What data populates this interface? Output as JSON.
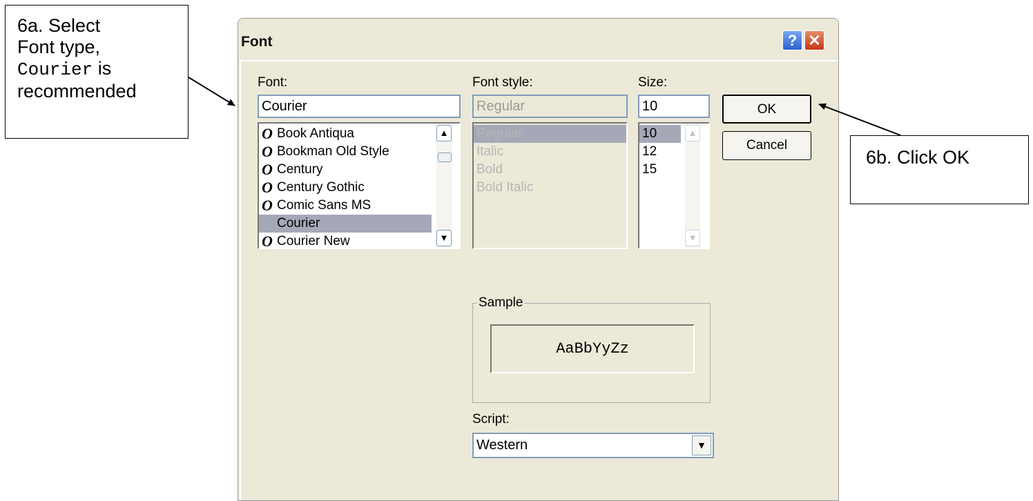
{
  "annotations": {
    "select_font": {
      "line1": "6a.   Select",
      "line2": "Font type,",
      "mono": "Courier",
      "after_mono": " is",
      "line4": "recommended"
    },
    "click_ok": {
      "text": "6b.   Click OK"
    }
  },
  "dialog": {
    "title": "Font",
    "help_glyph": "?",
    "close_glyph": "✕",
    "font": {
      "label": "Font:",
      "value": "Courier",
      "items": [
        {
          "icon": "O",
          "name": "Book Antiqua"
        },
        {
          "icon": "O",
          "name": "Bookman Old Style"
        },
        {
          "icon": "O",
          "name": "Century"
        },
        {
          "icon": "O",
          "name": "Century Gothic"
        },
        {
          "icon": "O",
          "name": "Comic Sans MS"
        },
        {
          "icon": "",
          "name": "Courier",
          "selected": true
        },
        {
          "icon": "O",
          "name": "Courier New"
        }
      ]
    },
    "style": {
      "label": "Font style:",
      "value": "Regular",
      "items": [
        "Regular",
        "Italic",
        "Bold",
        "Bold Italic"
      ]
    },
    "size": {
      "label": "Size:",
      "value": "10",
      "items": [
        "10",
        "12",
        "15"
      ]
    },
    "ok": "OK",
    "cancel": "Cancel",
    "sample": {
      "label": "Sample",
      "text": "AaBbYyZz"
    },
    "script": {
      "label": "Script:",
      "value": "Western"
    }
  },
  "colors": {
    "window_bg": "#ECE9D8",
    "selection": "#a5a9b7",
    "disabled_text": "#b5b5b5"
  },
  "icons": {
    "truetype": "truetype-icon",
    "scroll_up": "scroll-up-icon",
    "scroll_down": "scroll-down-icon",
    "dropdown": "dropdown-arrow-icon"
  }
}
